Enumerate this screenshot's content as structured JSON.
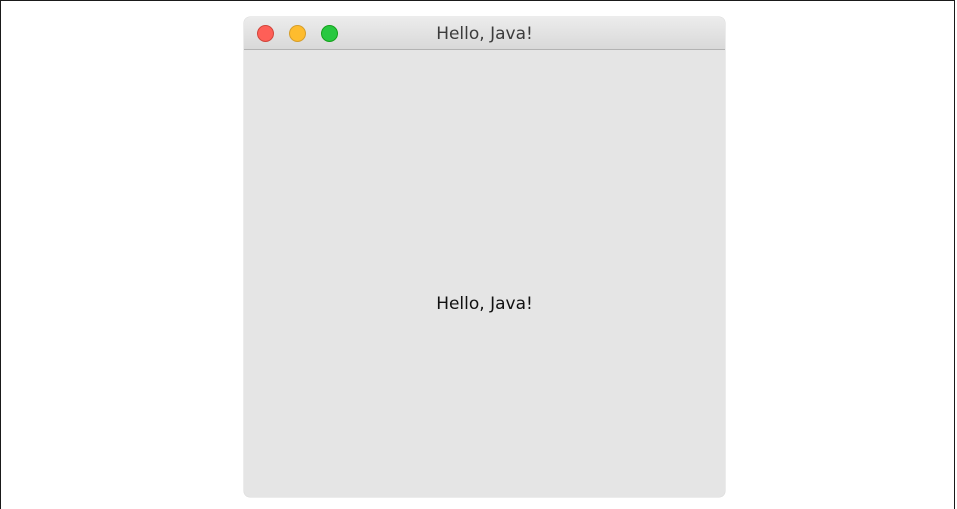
{
  "window": {
    "title": "Hello, Java!",
    "controls": {
      "close": {
        "icon": "close-traffic-light-icon",
        "color": "#fe5f57"
      },
      "minimize": {
        "icon": "minimize-traffic-light-icon",
        "color": "#febc2e"
      },
      "zoom": {
        "icon": "zoom-traffic-light-icon",
        "color": "#28c840"
      }
    }
  },
  "content": {
    "label": "Hello, Java!"
  }
}
